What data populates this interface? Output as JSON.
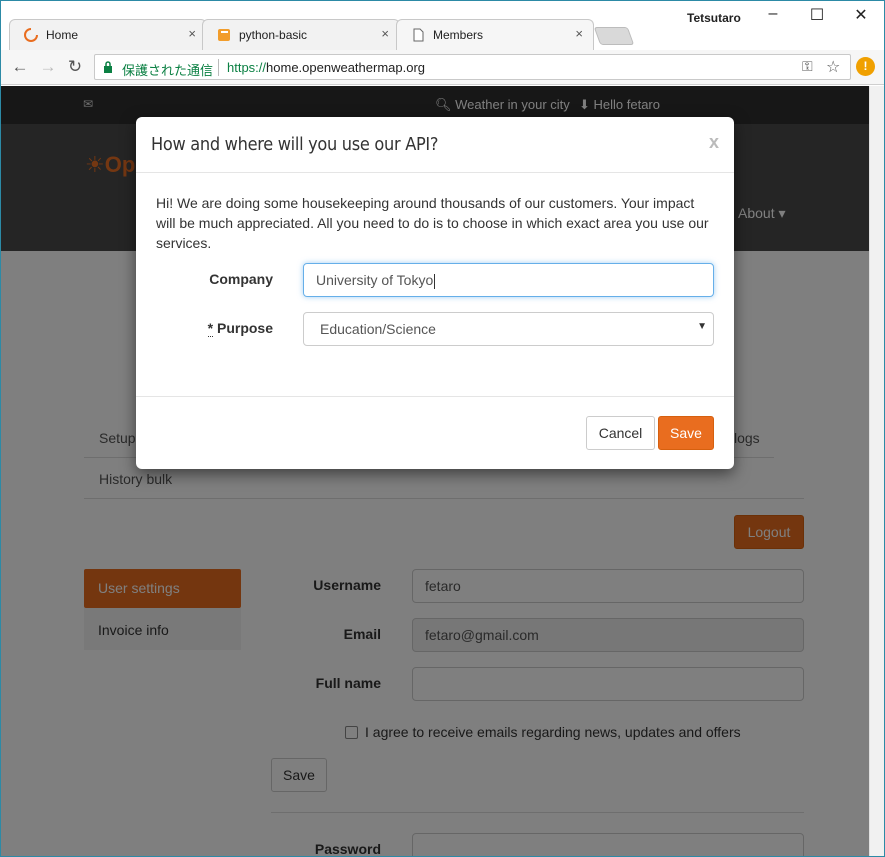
{
  "browser": {
    "tabs": [
      {
        "title": "Home",
        "icon": "loading-icon"
      },
      {
        "title": "python-basic",
        "icon": "notebook-icon"
      },
      {
        "title": "Members",
        "icon": "page-icon"
      }
    ],
    "close_glyph": "×",
    "user": "Tetsutaro",
    "secure_label": "保護された通信",
    "url_scheme": "https://",
    "url_host": "home.openweathermap.org",
    "alert_glyph": "!"
  },
  "site": {
    "topbar": {
      "weather_link": "Weather in your city",
      "hello": "Hello fetaro"
    },
    "logo_text": "Op",
    "about": "About ▾",
    "subtabs": {
      "setup": "Setup",
      "logs": "logs",
      "history": "History bulk"
    },
    "logout": "Logout",
    "sidenav": {
      "user_settings": "User settings",
      "invoice_info": "Invoice info"
    },
    "form": {
      "username_label": "Username",
      "username_value": "fetaro",
      "email_label": "Email",
      "email_value": "fetaro@gmail.com",
      "fullname_label": "Full name",
      "fullname_value": "",
      "agree_label": "I agree to receive emails regarding news, updates and offers",
      "save": "Save",
      "password_label": "Password"
    }
  },
  "modal": {
    "title": "How and where will you use our API?",
    "close": "x",
    "body": "Hi! We are doing some housekeeping around thousands of our customers. Your impact will be much appreciated. All you need to do is to choose in which exact area you use our services.",
    "company_label": "Company",
    "company_value": "University of Tokyo",
    "purpose_required": "*",
    "purpose_label": "Purpose",
    "purpose_value": "Education/Science",
    "cancel": "Cancel",
    "save": "Save"
  },
  "colors": {
    "accent": "#e96d1f",
    "topbar": "#2f2f2f",
    "header": "#4a4a4a",
    "secure": "#0b8043"
  }
}
